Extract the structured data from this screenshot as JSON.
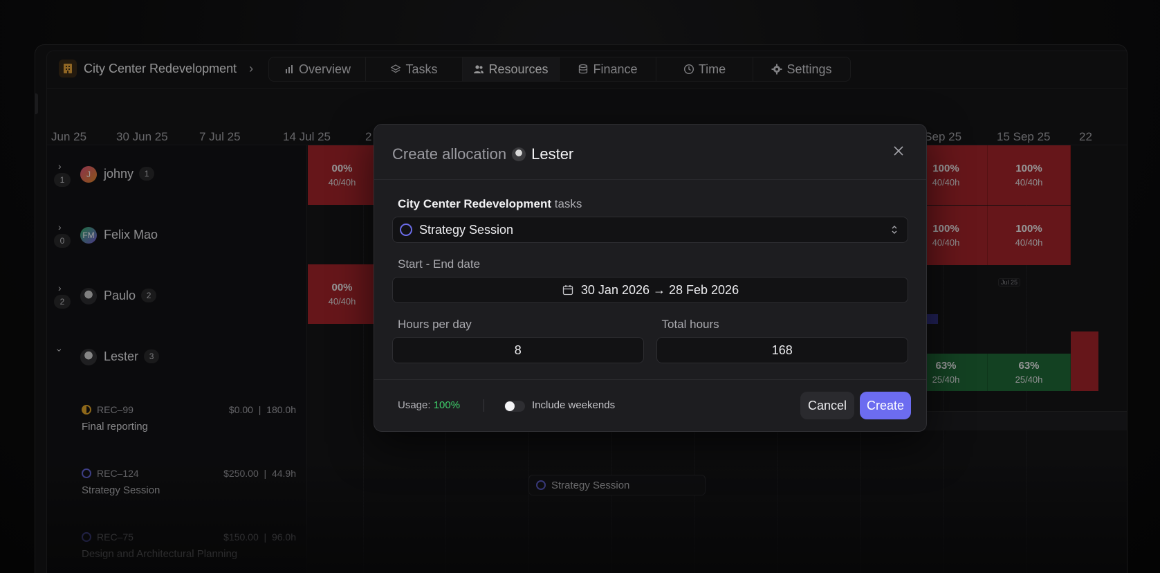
{
  "header": {
    "project_name": "City Center Redevelopment",
    "tabs": [
      {
        "label": "Overview",
        "icon": "bar-chart-icon"
      },
      {
        "label": "Tasks",
        "icon": "layers-icon"
      },
      {
        "label": "Resources",
        "icon": "users-icon",
        "active": true
      },
      {
        "label": "Finance",
        "icon": "database-icon"
      },
      {
        "label": "Time",
        "icon": "clock-icon"
      },
      {
        "label": "Settings",
        "icon": "gear-icon"
      }
    ]
  },
  "timeline": {
    "dates": [
      "Jun 25",
      "30 Jun 25",
      "7 Jul 25",
      "14 Jul 25",
      "2",
      "8 Sep 25",
      "15 Sep 25",
      "22"
    ],
    "marker": "Jul 25",
    "chip": "Strategy Session"
  },
  "people": [
    {
      "name": "johny",
      "count": "1",
      "badge": "1",
      "initials": "J"
    },
    {
      "name": "Felix Mao",
      "count": "0",
      "initials": "FM"
    },
    {
      "name": "Paulo",
      "count": "2",
      "badge": "2"
    },
    {
      "name": "Lester",
      "badge": "3"
    }
  ],
  "tasks": [
    {
      "id": "REC–99",
      "cost": "$0.00",
      "hours": "180.0h",
      "name": "Final reporting"
    },
    {
      "id": "REC–124",
      "cost": "$250.00",
      "hours": "44.9h",
      "name": "Strategy Session"
    },
    {
      "id": "REC–75",
      "cost": "$150.00",
      "hours": "96.0h",
      "name": "Design and Architectural Planning"
    }
  ],
  "cells": {
    "full_pct": "100%",
    "full_hrs": "40/40h",
    "partial_pct": "63%",
    "partial_hrs": "25/40h",
    "left_pct": "00%",
    "left_hrs": "40/40h"
  },
  "modal": {
    "title": "Create allocation",
    "person": "Lester",
    "project": "City Center Redevelopment",
    "tasks_suffix": "tasks",
    "task_value": "Strategy Session",
    "date_label": "Start - End date",
    "date_value": "30 Jan 2026 → 28 Feb 2026",
    "hours_label": "Hours per day",
    "hours_value": "8",
    "total_label": "Total hours",
    "total_value": "168",
    "usage_label": "Usage:",
    "usage_value": "100%",
    "weekends_label": "Include weekends",
    "cancel": "Cancel",
    "create": "Create"
  },
  "colors": {
    "accent": "#6c6cf0",
    "overload": "#a5252a",
    "partial": "#1f6a37",
    "usage_ok": "#3ecf6a"
  }
}
